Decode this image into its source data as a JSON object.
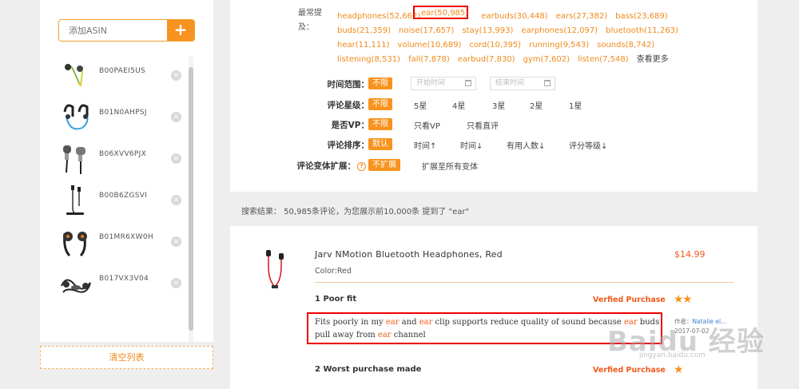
{
  "sidebar": {
    "add_placeholder": "添加ASIN",
    "add_button": "+",
    "items": [
      {
        "asin": "B00PAEI5US"
      },
      {
        "asin": "B01N0AHPSJ"
      },
      {
        "asin": "B06XVV6PJX"
      },
      {
        "asin": "B00B6ZGSVI"
      },
      {
        "asin": "B01MR6XW0H"
      },
      {
        "asin": "B017VX3V04"
      }
    ],
    "remove_icon": "×",
    "clear_label": "清空列表"
  },
  "filters": {
    "keywords_label": "最常提及：",
    "keywords": [
      [
        "headphones(52,662)",
        "",
        "earbuds(30,448)",
        "ears(27,382)",
        "bass(23,689)"
      ],
      [
        "buds(21,359)",
        "noise(17,657)",
        "stay(13,993)",
        "earphones(12,097)",
        "bluetooth(11,263)"
      ],
      [
        "hear(11,111)",
        "volume(10,689)",
        "cord(10,395)",
        "running(9,543)",
        "sounds(8,742)"
      ],
      [
        "listening(8,531)",
        "fall(7,878)",
        "earbud(7,830)",
        "gym(7,602)",
        "listen(7,548)"
      ]
    ],
    "selected_keyword": "ear(50,985)",
    "more_label": "查看更多",
    "time_range": {
      "label": "时间范围：",
      "tag": "不限",
      "start_placeholder": "开始时间",
      "end_placeholder": "结束时间"
    },
    "rating": {
      "label": "评论星级：",
      "tag": "不限",
      "options": [
        "5星",
        "4星",
        "3星",
        "2星",
        "1星"
      ]
    },
    "vp": {
      "label": "是否VP：",
      "tag": "不限",
      "options": [
        "只看VP",
        "只看直评"
      ]
    },
    "sort": {
      "label": "评论排序：",
      "tag": "默认",
      "options": [
        "时间↑",
        "时间↓",
        "有用人数↓",
        "评分等级↓"
      ]
    },
    "variant": {
      "label": "评论变体扩展：",
      "help_icon": "?",
      "tag": "不扩展",
      "options": [
        "扩展至所有变体"
      ]
    }
  },
  "result_summary": "搜索结果：  50,985条评论，为您展示前10,000条 提到了 \"ear\"",
  "product": {
    "title": "Jarv NMotion Bluetooth Headphones, Red",
    "color": "Color:Red",
    "price": "$14.99"
  },
  "reviews": [
    {
      "heading": "1   Poor fit",
      "verified": "Verfied Purchase",
      "stars": 2,
      "body_parts": [
        {
          "t": "Fits poorly in my ",
          "hl": false
        },
        {
          "t": "ear",
          "hl": true
        },
        {
          "t": " and ",
          "hl": false
        },
        {
          "t": "ear",
          "hl": true
        },
        {
          "t": " clip supports reduce quality of sound because ",
          "hl": false
        },
        {
          "t": "ear",
          "hl": true
        },
        {
          "t": " buds pull away from ",
          "hl": false
        },
        {
          "t": "ear",
          "hl": true
        },
        {
          "t": " channel",
          "hl": false
        }
      ],
      "author_prefix": "作者：",
      "author": "Natalie el...",
      "date": "2017-07-02"
    },
    {
      "heading": "2   Worst purchase made",
      "verified": "Verfied Purchase",
      "stars": 1
    }
  ],
  "watermark": "Baidu 经验",
  "watermark_sub": "jingyan.baidu.com",
  "colors": {
    "accent": "#f7931e",
    "highlight": "#f05a1a",
    "box": "#e00000"
  }
}
